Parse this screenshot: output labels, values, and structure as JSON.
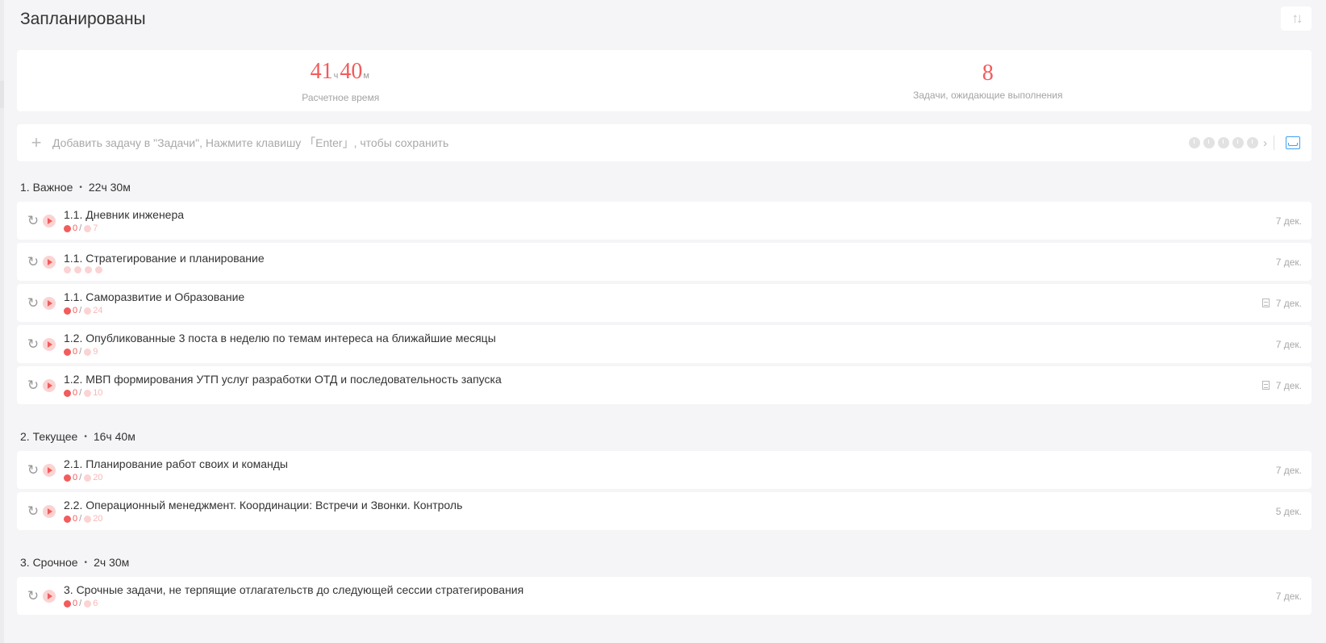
{
  "header": {
    "title": "Запланированы",
    "sort_icon": "sort-icon",
    "sort_glyph": "↑↓"
  },
  "stats": {
    "time_hours": "41",
    "time_hours_unit": "ч",
    "time_minutes": "40",
    "time_minutes_unit": "м",
    "time_label": "Расчетное время",
    "tasks_count": "8",
    "tasks_label": "Задачи, ожидающие выполнения"
  },
  "add_bar": {
    "plus": "+",
    "placeholder": "Добавить задачу в \"Задачи\", Нажмите клавишу 「Enter」, чтобы сохранить",
    "chevron": "›"
  },
  "groups": [
    {
      "title": "1. Важное",
      "dot": "•",
      "duration": "22ч 30м",
      "tasks": [
        {
          "name": "1.1. Дневник инженера",
          "done": "0",
          "slash": "/",
          "total": "7",
          "date": "7 дек.",
          "note": false,
          "empty_pomo": false
        },
        {
          "name": "1.1. Стратегирование и планирование",
          "done": "",
          "slash": "",
          "total": "",
          "date": "7 дек.",
          "note": false,
          "empty_pomo": true
        },
        {
          "name": "1.1. Саморазвитие и Образование",
          "done": "0",
          "slash": "/",
          "total": "24",
          "date": "7 дек.",
          "note": true,
          "empty_pomo": false
        },
        {
          "name": "1.2. Опубликованные 3 поста в неделю по темам интереса на ближайшие месяцы",
          "done": "0",
          "slash": "/",
          "total": "9",
          "date": "7 дек.",
          "note": false,
          "empty_pomo": false
        },
        {
          "name": "1.2. МВП формирования УТП услуг разработки ОТД и последовательность запуска",
          "done": "0",
          "slash": "/",
          "total": "10",
          "date": "7 дек.",
          "note": true,
          "empty_pomo": false
        }
      ]
    },
    {
      "title": "2. Текущее",
      "dot": "•",
      "duration": "16ч 40м",
      "tasks": [
        {
          "name": "2.1. Планирование работ своих и команды",
          "done": "0",
          "slash": "/",
          "total": "20",
          "date": "7 дек.",
          "note": false,
          "empty_pomo": false
        },
        {
          "name": "2.2. Операционный менеджмент. Координации: Встречи и Звонки. Контроль",
          "done": "0",
          "slash": "/",
          "total": "20",
          "date": "5 дек.",
          "note": false,
          "empty_pomo": false
        }
      ]
    },
    {
      "title": "3. Срочное",
      "dot": "•",
      "duration": "2ч 30м",
      "tasks": [
        {
          "name": "3. Срочные задачи, не терпящие отлагательств до следующей сессии стратегирования",
          "done": "0",
          "slash": "/",
          "total": "6",
          "date": "7 дек.",
          "note": false,
          "empty_pomo": false
        }
      ]
    }
  ],
  "colors": {
    "accent_red": "#f25c5c",
    "light_red": "#fbd3d3",
    "inbox_blue": "#3f9ff2"
  }
}
